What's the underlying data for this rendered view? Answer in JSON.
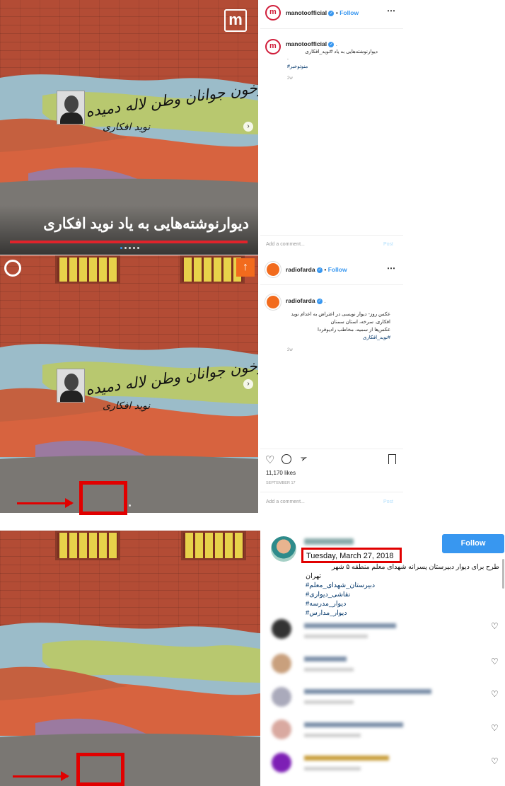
{
  "post1": {
    "logo_letter": "m",
    "username": "manotoofficial",
    "follow_label": "Follow",
    "caption_line1": "دیوارنوشته‌هایی به یاد #نوید_افکاری",
    "caption_dot": ".",
    "caption_hashtag": "#منوتوخبر",
    "time_ago": "2w",
    "overlay_headline": "دیوارنوشته‌هایی به یاد نوید افکاری",
    "comment_placeholder": "Add a comment...",
    "post_label": "Post"
  },
  "post2": {
    "username": "radiofarda",
    "follow_label": "Follow",
    "caption_line1": "عکس روز- دیوار نویسی در اعتراض به اعدام نوید",
    "caption_line2": "افکاری. سرخه، استان سمنان",
    "caption_line3": "عکس‌ها از سمیه، مخاطب رادیوفردا",
    "caption_hashtag": "#نوید_افکاری",
    "time_ago": "2w",
    "likes": "11,170 likes",
    "date": "SEPTEMBER 17",
    "comment_placeholder": "Add a comment...",
    "post_label": "Post"
  },
  "graffiti": {
    "line1": "ازخون جوانان وطن لاله دمیده",
    "line2": "نوید افکاری"
  },
  "post3": {
    "follow_label": "Follow",
    "date": "Tuesday, March 27, 2018",
    "caption_line1": "طرح برای دیوار دبیرستان پسرانه شهدای معلم منطقه ۵ شهر",
    "caption_line2": "تهران",
    "hashtags": [
      "#دبیرستان_شهدای_معلم",
      "#نقاشی_دیواری",
      "#دیوار_مدرسه",
      "#دیوار_مدارس"
    ]
  },
  "colors": {
    "accent_blue": "#3897f0",
    "highlight_red": "#e10000",
    "brick": "#b34c35"
  }
}
